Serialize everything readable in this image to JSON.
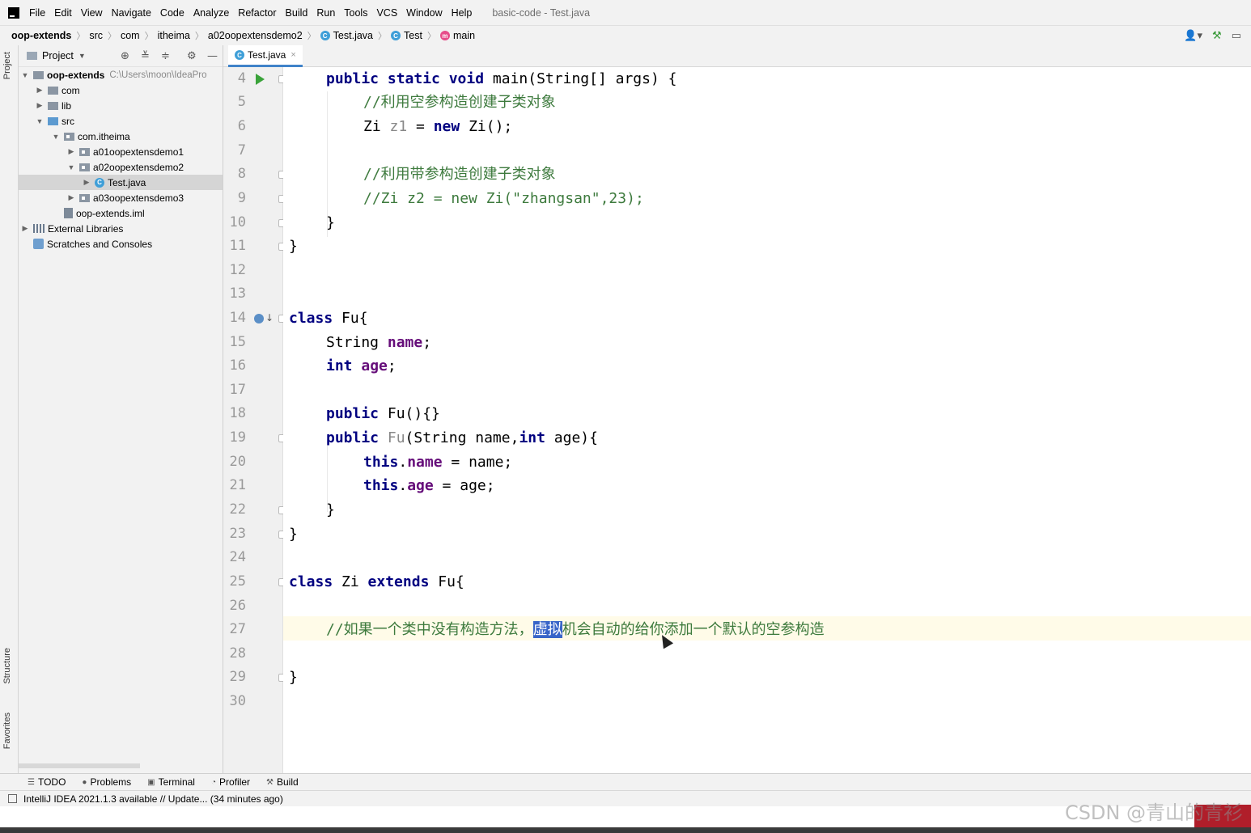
{
  "menubar": {
    "items": [
      "File",
      "Edit",
      "View",
      "Navigate",
      "Code",
      "Analyze",
      "Refactor",
      "Build",
      "Run",
      "Tools",
      "VCS",
      "Window",
      "Help"
    ],
    "window_title": "basic-code - Test.java"
  },
  "breadcrumb": {
    "items": [
      "oop-extends",
      "src",
      "com",
      "itheima",
      "a02oopextensdemo2",
      "Test.java",
      "Test",
      "main"
    ]
  },
  "project_panel": {
    "title": "Project",
    "side_tab": "Project",
    "tree": [
      {
        "label": "oop-extends",
        "hint": "C:\\Users\\moon\\IdeaPro"
      },
      {
        "label": "com"
      },
      {
        "label": "lib"
      },
      {
        "label": "src"
      },
      {
        "label": "com.itheima"
      },
      {
        "label": "a01oopextensdemo1"
      },
      {
        "label": "a02oopextensdemo2"
      },
      {
        "label": "Test.java"
      },
      {
        "label": "a03oopextensdemo3"
      },
      {
        "label": "oop-extends.iml"
      },
      {
        "label": "External Libraries"
      },
      {
        "label": "Scratches and Consoles"
      }
    ]
  },
  "side_tabs": {
    "structure": "Structure",
    "favorites": "Favorites"
  },
  "editor": {
    "tab_label": "Test.java",
    "line_numbers": [
      "4",
      "5",
      "6",
      "7",
      "8",
      "9",
      "10",
      "11",
      "12",
      "13",
      "14",
      "15",
      "16",
      "17",
      "18",
      "19",
      "20",
      "21",
      "22",
      "23",
      "24",
      "25",
      "26",
      "27",
      "28",
      "29",
      "30"
    ],
    "lines": {
      "l4": {
        "kw1": "public static void",
        "rest": " main(String[] args) {"
      },
      "l5": "//利用空参构造创建子类对象",
      "l6": {
        "a": "Zi ",
        "b": "z1",
        "c": " = ",
        "kw": "new",
        "d": " Zi();"
      },
      "l8": "//利用带参构造创建子类对象",
      "l9": "//Zi z2 = new Zi(\"zhangsan\",23);",
      "l10": "}",
      "l11": "}",
      "l14": {
        "kw": "class",
        "rest": " Fu{"
      },
      "l15": {
        "a": "String ",
        "fld": "name",
        ";": ";"
      },
      "l16": {
        "kw": "int",
        "sp": " ",
        "fld": "age",
        ";": ";"
      },
      "l18": {
        "kw": "public",
        "rest": " Fu(){}"
      },
      "l19": {
        "kw": "public",
        "fu": " Fu",
        "p1": "(String name,",
        "kw2": "int",
        "p2": " age){"
      },
      "l20": {
        "kw": "this",
        "dot": ".",
        "fld": "name",
        "rest": " = name;"
      },
      "l21": {
        "kw": "this",
        "dot": ".",
        "fld": "age",
        "rest": " = age;"
      },
      "l22": "}",
      "l23": "}",
      "l25": {
        "kw": "class",
        "mid": " Zi ",
        "kw2": "extends",
        "rest": " Fu{"
      },
      "l27": {
        "pre": "//如果一个类中没有构造方法，",
        "sel": "虚拟",
        "post": "机会自动的给你添加一个默认的空参构造"
      },
      "l29": "}"
    }
  },
  "bottom_tools": [
    "TODO",
    "Problems",
    "Terminal",
    "Profiler",
    "Build"
  ],
  "status": "IntelliJ IDEA 2021.1.3 available // Update... (34 minutes ago)",
  "watermark": "CSDN @青山的青衫"
}
